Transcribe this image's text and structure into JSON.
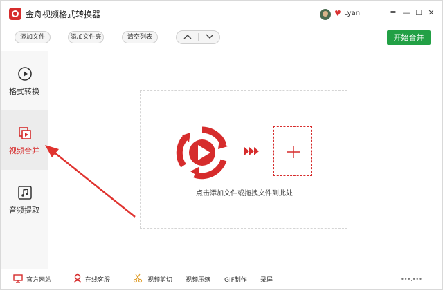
{
  "app": {
    "title": "金舟视频格式转换器"
  },
  "user": {
    "name": "Lyan"
  },
  "window_controls": {
    "menu": "≡",
    "minimize": "—",
    "maximize": "☐",
    "close": "✕"
  },
  "toolbar": {
    "add_file": "添加文件",
    "add_folder": "添加文件夹",
    "clear_list": "清空列表",
    "start": "开始合并"
  },
  "sidebar": {
    "items": [
      {
        "label": "格式转换",
        "icon": "play-circle-icon"
      },
      {
        "label": "视频合并",
        "icon": "video-merge-icon"
      },
      {
        "label": "音频提取",
        "icon": "music-note-icon"
      }
    ],
    "active_index": 1
  },
  "main": {
    "drop_hint": "点击添加文件或拖拽文件到此处"
  },
  "bottombar": {
    "website": "官方网站",
    "support": "在线客服",
    "video_cut": "视频剪切",
    "video_compress": "视频压缩",
    "gif": "GIF制作",
    "record": "录屏",
    "watermark": "•••.•••"
  },
  "colors": {
    "accent": "#d62c2c",
    "start": "#22a045",
    "annotation": "#e0332f"
  }
}
